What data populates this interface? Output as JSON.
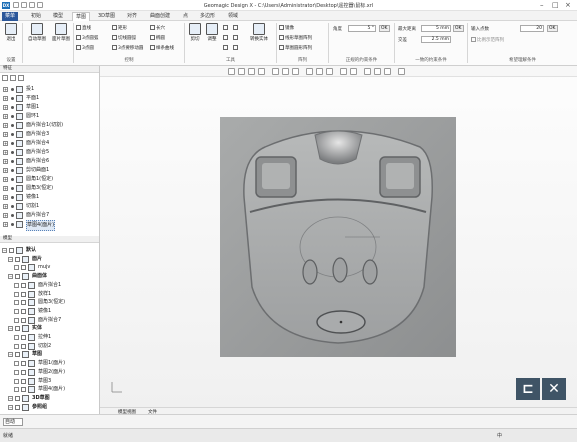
{
  "app": {
    "title": "Geomagic Design X - C:\\Users\\Administrator\\Desktop\\遥控器\\鼠标.xrl",
    "logo": "DX"
  },
  "menu_tabs": [
    "菜单",
    "初始",
    "模型",
    "草图",
    "3D草图",
    "对齐",
    "曲面创建",
    "点",
    "多边形",
    "领域"
  ],
  "ribbon": {
    "groups": {
      "settings": "设置",
      "control": "控制",
      "tools": "工具",
      "array": "阵列",
      "orthogonal": "正规的约束条件",
      "common": "一致的约束条件",
      "field": "希望理解条件"
    },
    "big_buttons": {
      "exit": "退出",
      "auto_sketch": "自动草图",
      "mesh_sketch": "面片草图",
      "offset": "剪切",
      "adjust": "调整",
      "convert": "转换实体"
    },
    "control_items": [
      "直线",
      "矩形",
      "长穴",
      "3点圆弧",
      "3点圆",
      "样条曲线",
      "切线圆弧",
      "椭圆",
      "多段线",
      "3点要移动圆"
    ],
    "mirror": "镜像",
    "linear_array": "线形草图阵列",
    "circular_array": "草图圆形阵列",
    "angle_label": "角度",
    "angle_value": "5 °",
    "max_dist_label": "最大距离",
    "max_dist_value": "5 mm",
    "intersect_label": "交差",
    "intersect_value": "2.5 mm",
    "ok": "OK",
    "tolerance_label": "输入点数",
    "tolerance_value": "20",
    "spline_check": "比例示范阵列"
  },
  "feature_tree": {
    "title": "特征",
    "items": [
      {
        "label": "投1",
        "type": "plane"
      },
      {
        "label": "平面1",
        "type": "plane"
      },
      {
        "label": "草图1",
        "type": "sketch"
      },
      {
        "label": "圆环1",
        "type": "feature"
      },
      {
        "label": "面片拟合1(切割)",
        "type": "fit"
      },
      {
        "label": "面片拟合3",
        "type": "fit"
      },
      {
        "label": "面片拟合4",
        "type": "fit"
      },
      {
        "label": "面片拟合5",
        "type": "fit"
      },
      {
        "label": "面片拟合6",
        "type": "fit"
      },
      {
        "label": "剪切曲面1",
        "type": "trim"
      },
      {
        "label": "圆角1(恒定)",
        "type": "fillet"
      },
      {
        "label": "圆角3(恒定)",
        "type": "fillet"
      },
      {
        "label": "镜像1",
        "type": "mirror"
      },
      {
        "label": "切割1",
        "type": "cut"
      },
      {
        "label": "面片拟合7",
        "type": "fit"
      },
      {
        "label": "草图4(面片)",
        "type": "sketch",
        "selected": true
      }
    ]
  },
  "model_tree": {
    "title": "模型",
    "items": [
      {
        "label": "默认",
        "level": 0
      },
      {
        "label": "面片",
        "level": 1
      },
      {
        "label": "mujv",
        "level": 2
      },
      {
        "label": "曲面体",
        "level": 1
      },
      {
        "label": "面片拟合1",
        "level": 2
      },
      {
        "label": "放样1",
        "level": 2
      },
      {
        "label": "圆角3(恒定)",
        "level": 2
      },
      {
        "label": "镜像1",
        "level": 2
      },
      {
        "label": "面片拟合7",
        "level": 2
      },
      {
        "label": "实体",
        "level": 1
      },
      {
        "label": "拉伸1",
        "level": 2
      },
      {
        "label": "切割2",
        "level": 2
      },
      {
        "label": "草图",
        "level": 1
      },
      {
        "label": "草图1(面片)",
        "level": 2
      },
      {
        "label": "草图2(面片)",
        "level": 2
      },
      {
        "label": "草图3",
        "level": 2
      },
      {
        "label": "草图4(面片)",
        "level": 2
      },
      {
        "label": "3D草图",
        "level": 1
      },
      {
        "label": "参照组",
        "level": 1
      }
    ]
  },
  "viewport": {
    "bottom_tabs": [
      "模型视图",
      "文件"
    ],
    "exit_icon": "exit-sketch-icon",
    "cancel_icon": "cancel-icon"
  },
  "status": {
    "text": "就绪",
    "select_mode": "自动",
    "ime": "中"
  },
  "colors": {
    "file_tab": "#2b579a",
    "big_icon_bg": "#3f5466",
    "selection": "#dfe9f6"
  }
}
